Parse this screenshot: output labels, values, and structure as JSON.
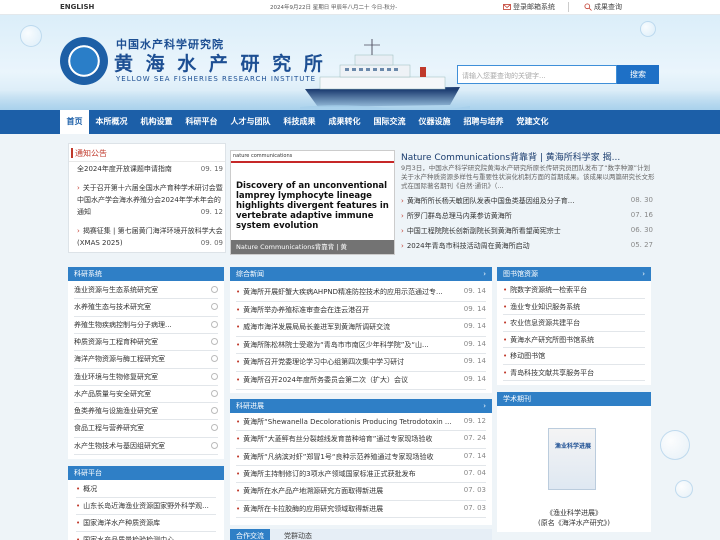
{
  "topbar": {
    "english": "ENGLISH",
    "date": "2024年9月22日  星期日  甲辰年八月二十  今日-秋分-",
    "mail_login": "登录邮箱系统",
    "result_query": "成果查询"
  },
  "header": {
    "org_cn": "中国水产科学研究院",
    "inst_cn": "黄 海 水 产 研 究 所",
    "inst_en": "YELLOW SEA FISHERIES RESEARCH INSTITUTE",
    "search_placeholder": "请输入您要查询的关键字...",
    "search_button": "搜索"
  },
  "nav": [
    "首页",
    "本所概况",
    "机构设置",
    "科研平台",
    "人才与团队",
    "科技成果",
    "成果转化",
    "国际交流",
    "仪器设施",
    "招聘与培养",
    "党建文化"
  ],
  "notice": {
    "title": "通知公告",
    "items": [
      {
        "text": "全2024年度开放课题申请指南",
        "date": "09. 19"
      },
      {
        "text": "关于召开第十六届全国水产育种学术研讨会暨中国水产学会海水养殖分会2024年学术年会的通知",
        "date": "09. 12"
      },
      {
        "text": "揭赛征集 | 第七届黄门海洋环境开放科学大会(XMAS 2025)",
        "date": "09. 09"
      }
    ]
  },
  "feature": {
    "journal": "nature communications",
    "headline": "Discovery of an unconventional lamprey lymphocyte lineage highlights divergent features in vertebrate adaptive immune system evolution",
    "caption": "Nature Communications背靠背 | 黄",
    "lead_title": "Nature Communications背靠背 | 黄海所科学家 揭...",
    "lead_body": "9月3日，中国水产科学研究院黄海水产研究所原长传研究员团队发布了“数字种源”计划关于水产种质资源多样性与重要性状演化机制方面的首期成果。该成果以两篇研究长文形式在国际著名期刊《自然·通讯》（..."
  },
  "top_news": [
    {
      "text": "黄海所所长杨天敏团队发表中国鱼类基因组及分子育...",
      "date": "08. 30"
    },
    {
      "text": "所罗门群岛总理马内莱参访黄海所",
      "date": "07. 16"
    },
    {
      "text": "中国工程院院长创新副院长到黄海所看望蔺宪宗士",
      "date": "06. 30"
    },
    {
      "text": "2024年青岛市科技活动周在黄海所启动",
      "date": "05. 27"
    }
  ],
  "research_systems": {
    "title": "科研系统",
    "items": [
      "渔业资源与生态系统研究室",
      "水养殖生态与技术研究室",
      "养殖生物疾病控制与分子病理...",
      "种质资源与工程育种研究室",
      "海洋产物资源与酶工程研究室",
      "渔业环境与生物修复研究室",
      "水产品质量与安全研究室",
      "鱼类养殖与设施渔业研究室",
      "食品工程与营养研究室",
      "水产生物技术与基因组研究室"
    ]
  },
  "research_platforms": {
    "title": "科研平台",
    "items": [
      "概况",
      "山东长岛近海渔业资源国家野外科学观...",
      "国家海洋水产种质资源库",
      "国家水产品质量检验检测中心"
    ]
  },
  "news": {
    "title": "综合新闻",
    "items": [
      {
        "text": "黄海所开展虾蟹大疾病AHPND精准防控技术的应用示范通过专...",
        "date": "09. 14"
      },
      {
        "text": "黄海所举办养殖标准审查会在连云港召开",
        "date": "09. 14"
      },
      {
        "text": "威海市海洋发展局局长姜进军到黄海所调研交流",
        "date": "09. 14"
      },
      {
        "text": "黄海所陈松林院士受邀为“青岛市市南区少年科学院”及“山...",
        "date": "09. 14"
      },
      {
        "text": "黄海所召开党委理论学习中心组第四次集中学习研讨",
        "date": "09. 14"
      },
      {
        "text": "黄海所召开2024年度所务委员会第二次（扩大）会议",
        "date": "09. 14"
      }
    ]
  },
  "research_progress": {
    "title": "科研进展",
    "items": [
      {
        "text": "黄海所“Shewanella Decolorationis Producing Tetrodotoxin ...",
        "date": "09. 12"
      },
      {
        "text": "黄海所“大菱鲆有丝分裂越线发育苗种培育”通过专家现场验收",
        "date": "07. 24"
      },
      {
        "text": "黄海所“凡纳滨对虾”郑冒1号“良种示范养殖通过专家现场验收",
        "date": "07. 14"
      },
      {
        "text": "黄海所主持制修订的3项水产领域国家标准正式获批发布",
        "date": "07. 04"
      },
      {
        "text": "黄海所在水产品产地溯源研究方面取得新进展",
        "date": "07. 03"
      },
      {
        "text": "黄海所在卡拉胶酶的应用研究领域取得新进展",
        "date": "07. 03"
      }
    ]
  },
  "bottom_tabs": [
    "合作交流",
    "党群动态"
  ],
  "library": {
    "title": "图书馆资源",
    "items": [
      "院数字资源统一检索平台",
      "渔业专业知识服务系统",
      "农业信息资源共建平台",
      "黄海水产研究所图书馆系统",
      "移动图书馆",
      "青岛科技文献共享服务平台"
    ]
  },
  "journal": {
    "title": "学术期刊",
    "cover_text": "渔业科学进展",
    "name1": "《渔业科学进展》",
    "name2": "(原名《海洋水产研究》)"
  }
}
